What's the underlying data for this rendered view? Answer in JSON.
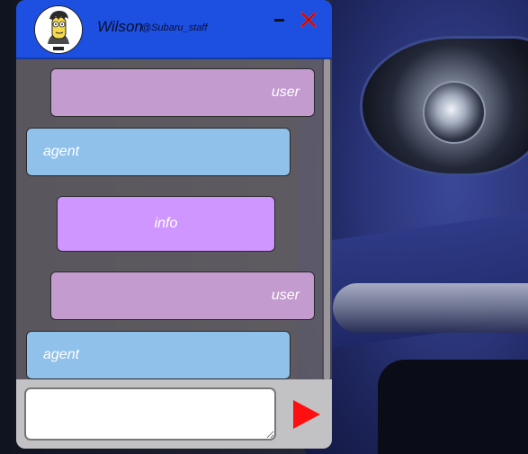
{
  "background": {
    "image": "blue-car-headlight"
  },
  "header": {
    "agent_name": "Wilson",
    "agent_handle": "@Subaru_staff",
    "avatar_icon": "cartoon-avatar-icon",
    "header_color": "#1d4fe0",
    "minimize_icon": "minimize-icon",
    "close_icon": "close-icon"
  },
  "messages": [
    {
      "role": "user",
      "text": "user"
    },
    {
      "role": "agent",
      "text": "agent"
    },
    {
      "role": "info",
      "text": "info"
    },
    {
      "role": "user",
      "text": "user"
    },
    {
      "role": "agent",
      "text": "agent"
    }
  ],
  "colors": {
    "user_bubble": "#c39bcf",
    "agent_bubble": "#8fc1ea",
    "info_bubble": "#cf96ff",
    "send_arrow": "#ff1010",
    "close_x": "#ff2020"
  },
  "composer": {
    "input_value": "",
    "send_icon": "send-arrow-icon"
  }
}
